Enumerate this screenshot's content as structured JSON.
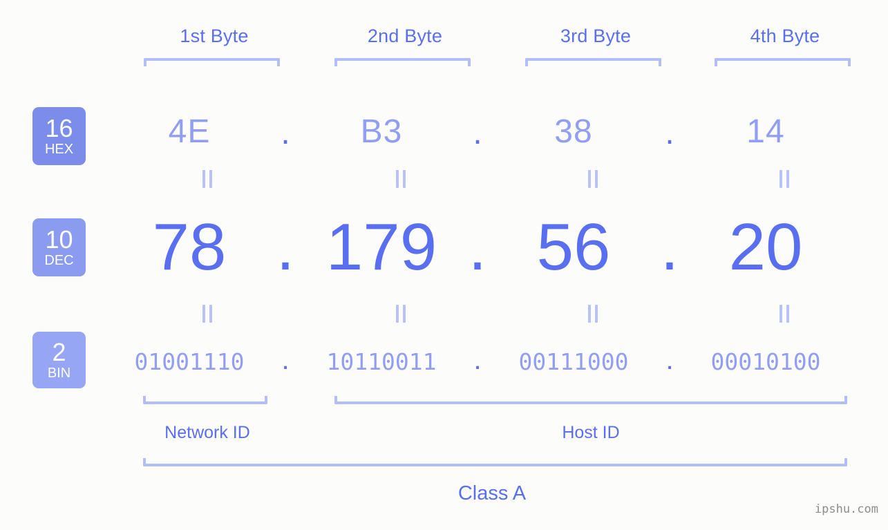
{
  "background_color": "#fcfdfa",
  "accent_strong": "#5a6ff0",
  "accent_light": "#919ef2",
  "bracket_color": "#b3bdf7",
  "byte_headers": [
    {
      "label": "1st Byte"
    },
    {
      "label": "2nd Byte"
    },
    {
      "label": "3rd Byte"
    },
    {
      "label": "4th Byte"
    }
  ],
  "bases": [
    {
      "number": "16",
      "abbr": "HEX",
      "color": "#7b8cea"
    },
    {
      "number": "10",
      "abbr": "DEC",
      "color": "#8b9bef"
    },
    {
      "number": "2",
      "abbr": "BIN",
      "color": "#96a6f4"
    }
  ],
  "separator": ".",
  "equals_glyph": "=",
  "rows": {
    "hex": {
      "base_label": "HEX",
      "values": [
        "4E",
        "B3",
        "38",
        "14"
      ]
    },
    "dec": {
      "base_label": "DEC",
      "values": [
        "78",
        "179",
        "56",
        "20"
      ]
    },
    "bin": {
      "base_label": "BIN",
      "values": [
        "01001110",
        "10110011",
        "00111000",
        "00010100"
      ]
    }
  },
  "address": {
    "hex": "4E.B3.38.14",
    "dec": "78.179.56.20",
    "bin": "01001110.10110011.00111000.00010100"
  },
  "segments": {
    "network_id": {
      "label": "Network ID"
    },
    "host_id": {
      "label": "Host ID"
    },
    "class": {
      "label": "Class A"
    }
  },
  "watermark": {
    "text": "ipshu.com"
  }
}
